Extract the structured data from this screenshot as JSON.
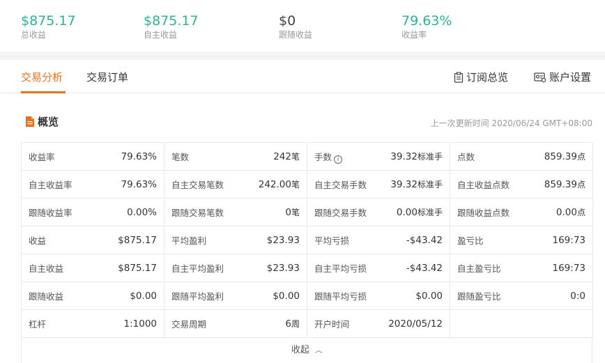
{
  "summary": [
    {
      "value": "$875.17",
      "label": "总收益",
      "color": "#2db295"
    },
    {
      "value": "$875.17",
      "label": "自主收益",
      "color": "#2db295"
    },
    {
      "value": "$0",
      "label": "跟随收益",
      "color": "#444444"
    },
    {
      "value": "79.63%",
      "label": "收益率",
      "color": "#2db295"
    }
  ],
  "tabs": {
    "analysis": "交易分析",
    "orders": "交易订单",
    "subscription": "订阅总览",
    "account_settings": "账户设置",
    "active_color": "#e8711e"
  },
  "overview": {
    "title": "概览",
    "updated": "上一次更新时间 2020/06/24 GMT+08:00",
    "collapse": "收起"
  },
  "rows": [
    [
      {
        "k": "收益率",
        "v": "79.63%",
        "u": ""
      },
      {
        "k": "笔数",
        "v": "242",
        "u": "笔"
      },
      {
        "k": "手数",
        "v": "39.32",
        "u": "标准手",
        "info": true
      },
      {
        "k": "点数",
        "v": "859.39",
        "u": "点"
      }
    ],
    [
      {
        "k": "自主收益率",
        "v": "79.63%",
        "u": ""
      },
      {
        "k": "自主交易笔数",
        "v": "242.00",
        "u": "笔"
      },
      {
        "k": "自主交易手数",
        "v": "39.32",
        "u": "标准手"
      },
      {
        "k": "自主收益点数",
        "v": "859.39",
        "u": "点"
      }
    ],
    [
      {
        "k": "跟随收益率",
        "v": "0.00%",
        "u": ""
      },
      {
        "k": "跟随交易笔数",
        "v": "0",
        "u": "笔"
      },
      {
        "k": "跟随交易手数",
        "v": "0.00",
        "u": "标准手"
      },
      {
        "k": "跟随收益点数",
        "v": "0.00",
        "u": "点"
      }
    ],
    [
      {
        "k": "收益",
        "v": "$875.17",
        "u": ""
      },
      {
        "k": "平均盈利",
        "v": "$23.93",
        "u": ""
      },
      {
        "k": "平均亏损",
        "v": "-$43.42",
        "u": ""
      },
      {
        "k": "盈亏比",
        "v": "169:73",
        "u": ""
      }
    ],
    [
      {
        "k": "自主收益",
        "v": "$875.17",
        "u": ""
      },
      {
        "k": "自主平均盈利",
        "v": "$23.93",
        "u": ""
      },
      {
        "k": "自主平均亏损",
        "v": "-$43.42",
        "u": ""
      },
      {
        "k": "自主盈亏比",
        "v": "169:73",
        "u": ""
      }
    ],
    [
      {
        "k": "跟随收益",
        "v": "$0.00",
        "u": ""
      },
      {
        "k": "跟随平均盈利",
        "v": "$0.00",
        "u": ""
      },
      {
        "k": "跟随平均亏损",
        "v": "$0.00",
        "u": ""
      },
      {
        "k": "跟随盈亏比",
        "v": "0:0",
        "u": ""
      }
    ],
    [
      {
        "k": "杠杆",
        "v": "1:1000",
        "u": ""
      },
      {
        "k": "交易周期",
        "v": "6",
        "u": "周"
      },
      {
        "k": "开户时间",
        "v": "2020/05/12",
        "u": ""
      },
      {
        "k": "",
        "v": "",
        "u": ""
      }
    ]
  ]
}
